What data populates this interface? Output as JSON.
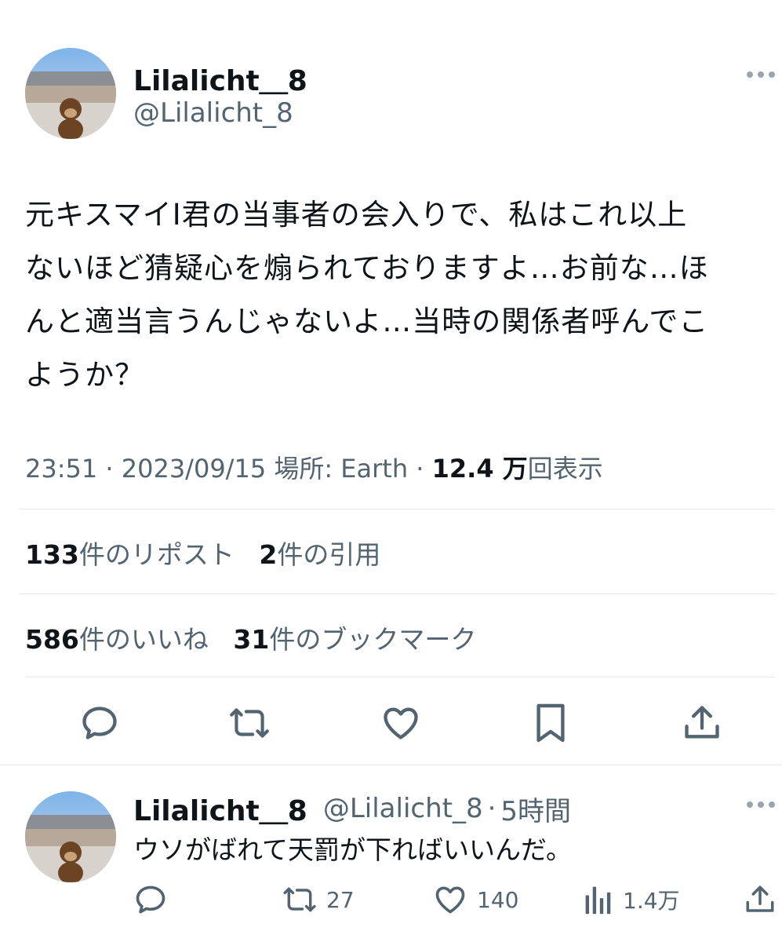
{
  "tweet": {
    "display_name": "Lilalicht＿8",
    "handle": "@Lilalicht_8",
    "text_lines": [
      "元キスマイI君の当事者の会入りで、私はこれ以上",
      "ないほど猜疑心を煽られておりますよ…お前な…ほ",
      "んと適当言うんじゃないよ…当時の関係者呼んでこ",
      "ようか？"
    ],
    "time": "23:51",
    "date": "2023/09/15",
    "location_label": "場所: Earth",
    "views_value": "12.4 万",
    "views_suffix": "回表示",
    "reposts_count": "133",
    "reposts_label": "件のリポスト",
    "quotes_count": "2",
    "quotes_label": "件の引用",
    "likes_count": "586",
    "likes_label": "件のいいね",
    "bookmarks_count": "31",
    "bookmarks_label": "件のブックマーク"
  },
  "actions": [
    "reply-icon",
    "repost-icon",
    "like-icon",
    "bookmark-icon",
    "share-icon"
  ],
  "reply": {
    "display_name": "Lilalicht＿8",
    "handle": "@Lilalicht_8",
    "time_sep": "·",
    "time": "5時間",
    "text": "ウソがばれて天罰が下ればいいんだ。",
    "repost_count": "27",
    "like_count": "140",
    "view_count": "1.4万"
  },
  "colors": {
    "text_primary": "#0f1419",
    "text_secondary": "#536471",
    "divider": "#e5e8eb"
  }
}
